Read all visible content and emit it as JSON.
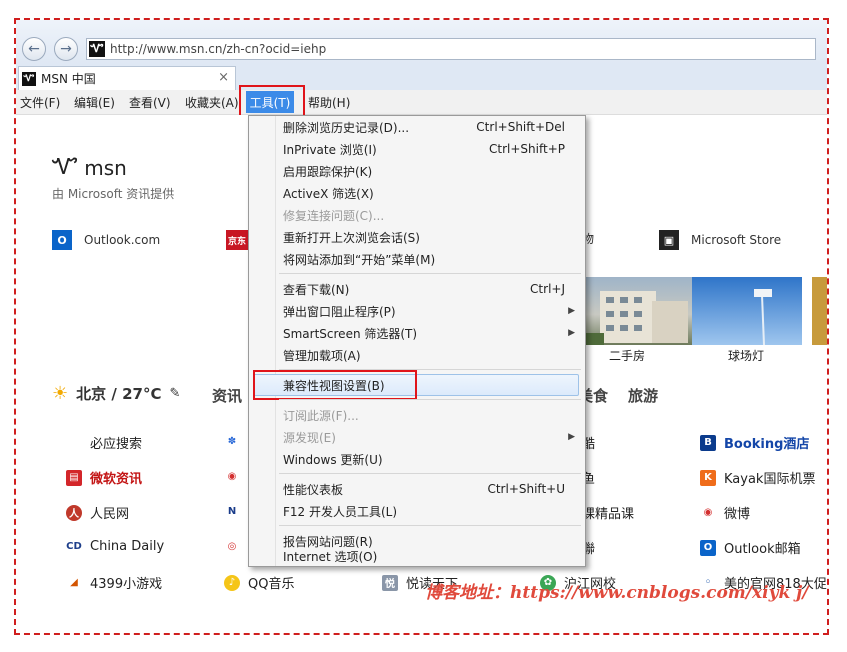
{
  "browser": {
    "url": "http://www.msn.cn/zh-cn?ocid=iehp",
    "tab_title": "MSN 中国",
    "tab_close": "×"
  },
  "menubar": {
    "items": [
      "文件(F)",
      "编辑(E)",
      "查看(V)",
      "收藏夹(A)",
      "工具(T)",
      "帮助(H)"
    ]
  },
  "tools_menu": {
    "items": [
      {
        "label": "删除浏览历史记录(D)...",
        "shortcut": "Ctrl+Shift+Del"
      },
      {
        "label": "InPrivate 浏览(I)",
        "shortcut": "Ctrl+Shift+P"
      },
      {
        "label": "启用跟踪保护(K)",
        "shortcut": ""
      },
      {
        "label": "ActiveX 筛选(X)",
        "shortcut": ""
      },
      {
        "label": "修复连接问题(C)...",
        "shortcut": ""
      },
      {
        "label": "重新打开上次浏览会话(S)",
        "shortcut": ""
      },
      {
        "label": "将网站添加到“开始”菜单(M)",
        "shortcut": ""
      },
      {
        "label": "查看下载(N)",
        "shortcut": "Ctrl+J"
      },
      {
        "label": "弹出窗口阻止程序(P)",
        "shortcut": ""
      },
      {
        "label": "SmartScreen 筛选器(T)",
        "shortcut": ""
      },
      {
        "label": "管理加载项(A)",
        "shortcut": ""
      },
      {
        "label": "兼容性视图设置(B)",
        "shortcut": ""
      },
      {
        "label": "订阅此源(F)...",
        "shortcut": ""
      },
      {
        "label": "源发现(E)",
        "shortcut": ""
      },
      {
        "label": "Windows 更新(U)",
        "shortcut": ""
      },
      {
        "label": "性能仪表板",
        "shortcut": "Ctrl+Shift+U"
      },
      {
        "label": "F12 开发人员工具(L)",
        "shortcut": ""
      },
      {
        "label": "报告网站问题(R)",
        "shortcut": ""
      },
      {
        "label": "Internet 选项(O)",
        "shortcut": ""
      }
    ]
  },
  "msn": {
    "logo": "msn",
    "provided_by": "由 Microsoft 资讯提供",
    "quick_links": [
      "Outlook.com",
      "Microsoft Store"
    ],
    "partial_labels": {
      "q2": "京东",
      "q3": "物"
    },
    "thumbs": [
      "二手房",
      "球场灯"
    ],
    "weather": "北京 / 27°C",
    "nav": [
      "资讯",
      "美食",
      "旅游"
    ],
    "links": {
      "col1": [
        "必应搜索",
        "微软资讯",
        "人民网",
        "China Daily",
        "4399小游戏"
      ],
      "col2": [
        "QQ音乐"
      ],
      "col3": [
        "悦读天下"
      ],
      "col4": [
        "酷",
        "鱼",
        "课精品课",
        "聯",
        "沪江网校"
      ],
      "col5": [
        "Booking酒店",
        "Kayak国际机票",
        "微博",
        "Outlook邮箱",
        "美的官网818大促"
      ]
    }
  },
  "watermark": "博客地址：https://www.cnblogs.com/xiyk j/"
}
